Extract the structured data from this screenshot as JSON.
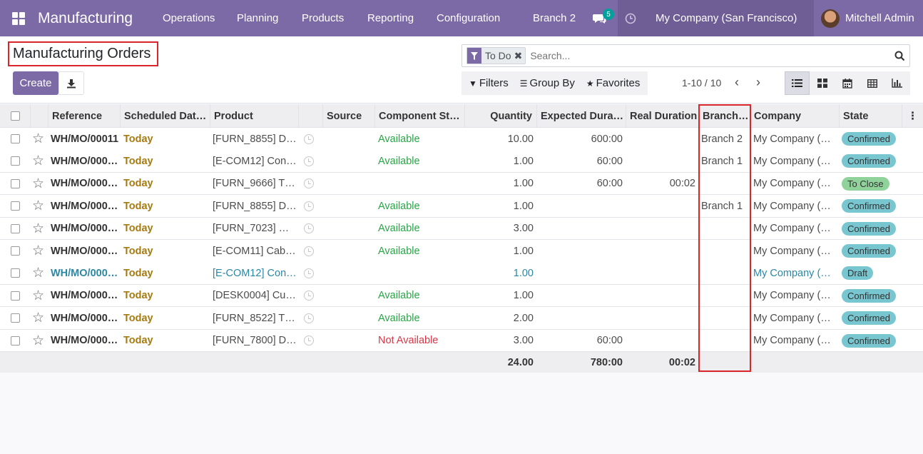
{
  "navbar": {
    "app_title": "Manufacturing",
    "menu": [
      "Operations",
      "Planning",
      "Products",
      "Reporting",
      "Configuration"
    ],
    "branch": "Branch 2",
    "chat_count": "5",
    "company": "My Company (San Francisco)",
    "user": "Mitchell Admin"
  },
  "page": {
    "title": "Manufacturing Orders",
    "create_label": "Create"
  },
  "search": {
    "facet_label": "To Do",
    "placeholder": "Search..."
  },
  "filters": {
    "filters_label": "Filters",
    "groupby_label": "Group By",
    "favorites_label": "Favorites"
  },
  "pager": {
    "value": "1-10 / 10"
  },
  "columns": [
    "Reference",
    "Scheduled Dat…",
    "Product",
    "Source",
    "Component St…",
    "Quantity",
    "Expected Dura…",
    "Real Duration",
    "Branch…",
    "Company",
    "State"
  ],
  "rows": [
    {
      "ref": "WH/MO/00011",
      "date": "Today",
      "product": "[FURN_8855] D…",
      "source": "",
      "component": "Available",
      "qty": "10.00",
      "expected": "600:00",
      "real": "",
      "branch": "Branch 2",
      "company": "My Company (…",
      "state": "Confirmed"
    },
    {
      "ref": "WH/MO/000…",
      "date": "Today",
      "product": "[E-COM12] Con…",
      "source": "",
      "component": "Available",
      "qty": "1.00",
      "expected": "60:00",
      "real": "",
      "branch": "Branch 1",
      "company": "My Company (…",
      "state": "Confirmed"
    },
    {
      "ref": "WH/MO/000…",
      "date": "Today",
      "product": "[FURN_9666] T…",
      "source": "",
      "component": "",
      "qty": "1.00",
      "expected": "60:00",
      "real": "00:02",
      "branch": "",
      "company": "My Company (…",
      "state": "To Close"
    },
    {
      "ref": "WH/MO/000…",
      "date": "Today",
      "product": "[FURN_8855] D…",
      "source": "",
      "component": "Available",
      "qty": "1.00",
      "expected": "",
      "real": "",
      "branch": "Branch 1",
      "company": "My Company (…",
      "state": "Confirmed"
    },
    {
      "ref": "WH/MO/000…",
      "date": "Today",
      "product": "[FURN_7023] …",
      "source": "",
      "component": "Available",
      "qty": "3.00",
      "expected": "",
      "real": "",
      "branch": "",
      "company": "My Company (…",
      "state": "Confirmed"
    },
    {
      "ref": "WH/MO/000…",
      "date": "Today",
      "product": "[E-COM11] Cab…",
      "source": "",
      "component": "Available",
      "qty": "1.00",
      "expected": "",
      "real": "",
      "branch": "",
      "company": "My Company (…",
      "state": "Confirmed"
    },
    {
      "ref": "WH/MO/000…",
      "date": "Today",
      "product": "[E-COM12] Con…",
      "source": "",
      "component": "",
      "qty": "1.00",
      "expected": "",
      "real": "",
      "branch": "",
      "company": "My Company (…",
      "state": "Draft"
    },
    {
      "ref": "WH/MO/000…",
      "date": "Today",
      "product": "[DESK0004] Cu…",
      "source": "",
      "component": "Available",
      "qty": "1.00",
      "expected": "",
      "real": "",
      "branch": "",
      "company": "My Company (…",
      "state": "Confirmed"
    },
    {
      "ref": "WH/MO/000…",
      "date": "Today",
      "product": "[FURN_8522] T…",
      "source": "",
      "component": "Available",
      "qty": "2.00",
      "expected": "",
      "real": "",
      "branch": "",
      "company": "My Company (…",
      "state": "Confirmed"
    },
    {
      "ref": "WH/MO/000…",
      "date": "Today",
      "product": "[FURN_7800] D…",
      "source": "",
      "component": "Not Available",
      "qty": "3.00",
      "expected": "60:00",
      "real": "",
      "branch": "",
      "company": "My Company (…",
      "state": "Confirmed"
    }
  ],
  "totals": {
    "qty": "24.00",
    "expected": "780:00",
    "real": "00:02"
  },
  "colors": {
    "brand": "#7c6aa6",
    "today": "#a77a10",
    "available": "#28a745",
    "not_available": "#dc3545",
    "highlight": "#d9262a"
  }
}
